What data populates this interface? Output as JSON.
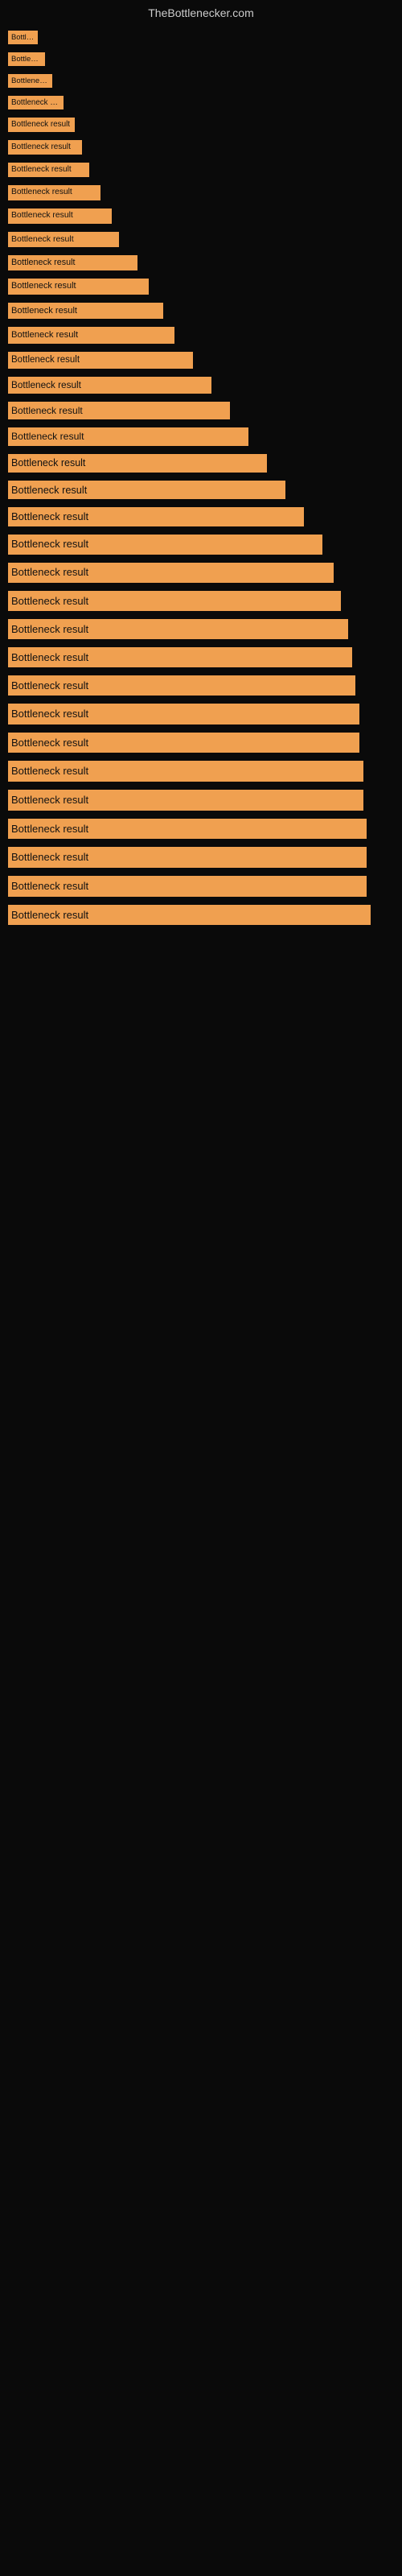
{
  "site": {
    "title": "TheBottlenecker.com"
  },
  "bars": [
    {
      "label": "Bottleneck result",
      "width": 8
    },
    {
      "label": "Bottleneck result",
      "width": 10
    },
    {
      "label": "Bottleneck result",
      "width": 12
    },
    {
      "label": "Bottleneck result",
      "width": 15
    },
    {
      "label": "Bottleneck result",
      "width": 18
    },
    {
      "label": "Bottleneck result",
      "width": 20
    },
    {
      "label": "Bottleneck result",
      "width": 22
    },
    {
      "label": "Bottleneck result",
      "width": 25
    },
    {
      "label": "Bottleneck result",
      "width": 28
    },
    {
      "label": "Bottleneck result",
      "width": 30
    },
    {
      "label": "Bottleneck result",
      "width": 35
    },
    {
      "label": "Bottleneck result",
      "width": 38
    },
    {
      "label": "Bottleneck result",
      "width": 42
    },
    {
      "label": "Bottleneck result",
      "width": 45
    },
    {
      "label": "Bottleneck result",
      "width": 50
    },
    {
      "label": "Bottleneck result",
      "width": 55
    },
    {
      "label": "Bottleneck result",
      "width": 60
    },
    {
      "label": "Bottleneck result",
      "width": 65
    },
    {
      "label": "Bottleneck result",
      "width": 70
    },
    {
      "label": "Bottleneck result",
      "width": 75
    },
    {
      "label": "Bottleneck result",
      "width": 80
    },
    {
      "label": "Bottleneck result",
      "width": 85
    },
    {
      "label": "Bottleneck result",
      "width": 88
    },
    {
      "label": "Bottleneck result",
      "width": 90
    },
    {
      "label": "Bottleneck result",
      "width": 92
    },
    {
      "label": "Bottleneck result",
      "width": 93
    },
    {
      "label": "Bottleneck result",
      "width": 94
    },
    {
      "label": "Bottleneck result",
      "width": 95
    },
    {
      "label": "Bottleneck result",
      "width": 95
    },
    {
      "label": "Bottleneck result",
      "width": 96
    },
    {
      "label": "Bottleneck result",
      "width": 96
    },
    {
      "label": "Bottleneck result",
      "width": 97
    },
    {
      "label": "Bottleneck result",
      "width": 97
    },
    {
      "label": "Bottleneck result",
      "width": 97
    },
    {
      "label": "Bottleneck result",
      "width": 98
    }
  ]
}
